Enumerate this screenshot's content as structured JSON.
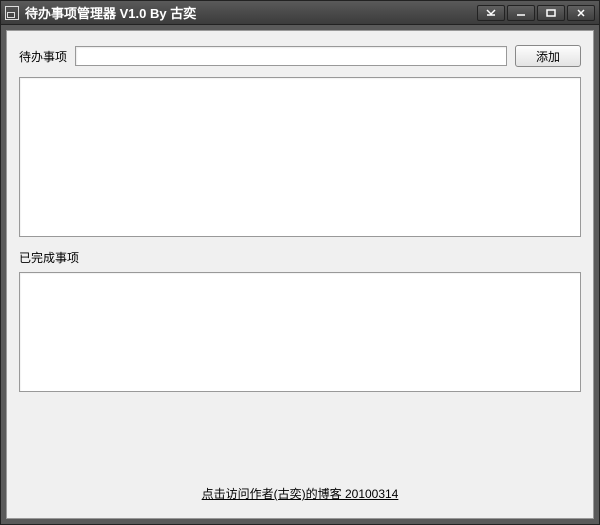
{
  "window": {
    "title": "待办事项管理器 V1.0  By 古奕"
  },
  "input": {
    "label": "待办事项",
    "value": "",
    "add_button": "添加"
  },
  "sections": {
    "completed_label": "已完成事项"
  },
  "footer": {
    "link_text": "点击访问作者(古奕)的博客   20100314"
  }
}
